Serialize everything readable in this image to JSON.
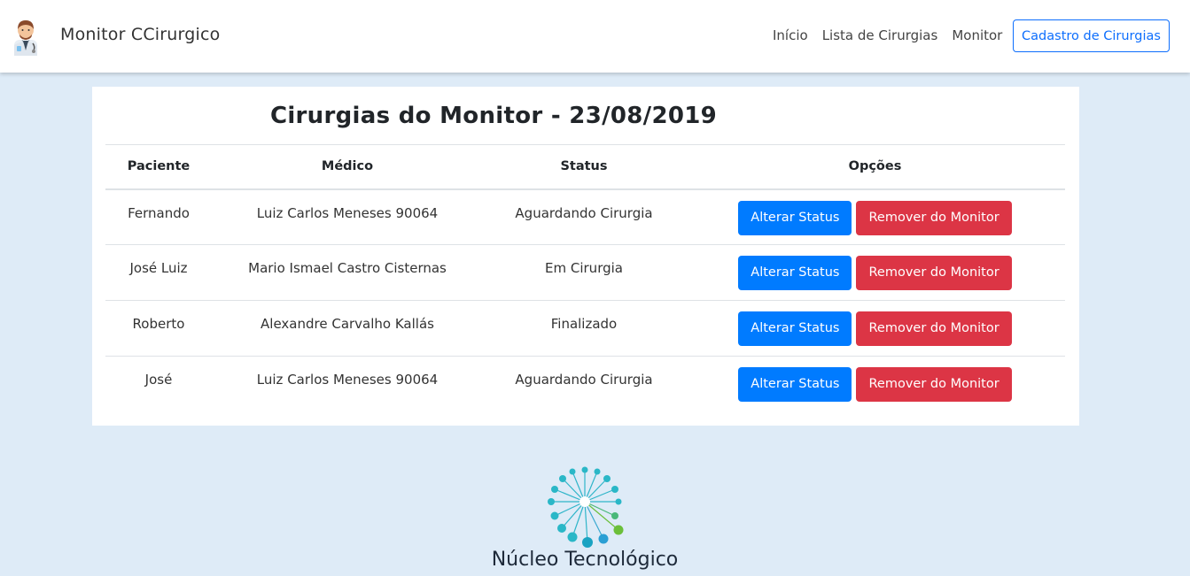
{
  "brand": {
    "title": "Monitor CCirurgico",
    "icon": "doctor-avatar-icon"
  },
  "nav": {
    "links": [
      "Início",
      "Lista de Cirurgias",
      "Monitor"
    ],
    "cta": "Cadastro de Cirurgias"
  },
  "card": {
    "title": "Cirurgias do Monitor - 23/08/2019",
    "columns": [
      "Paciente",
      "Médico",
      "Status",
      "Opções"
    ],
    "rows": [
      {
        "paciente": "Fernando",
        "medico": "Luiz Carlos Meneses 90064",
        "status": "Aguardando Cirurgia"
      },
      {
        "paciente": "José Luiz",
        "medico": "Mario Ismael Castro Cisternas",
        "status": "Em Cirurgia"
      },
      {
        "paciente": "Roberto",
        "medico": "Alexandre Carvalho Kallás",
        "status": "Finalizado"
      },
      {
        "paciente": "José",
        "medico": "Luiz Carlos Meneses 90064",
        "status": "Aguardando Cirurgia"
      }
    ],
    "actions": {
      "alter": "Alterar Status",
      "remove": "Remover do Monitor"
    }
  },
  "footer": {
    "text": "Núcleo Tecnológico",
    "icon": "nucleo-logo-icon"
  },
  "colors": {
    "primary": "#007bff",
    "danger": "#dc3545",
    "background": "#deebf7"
  }
}
